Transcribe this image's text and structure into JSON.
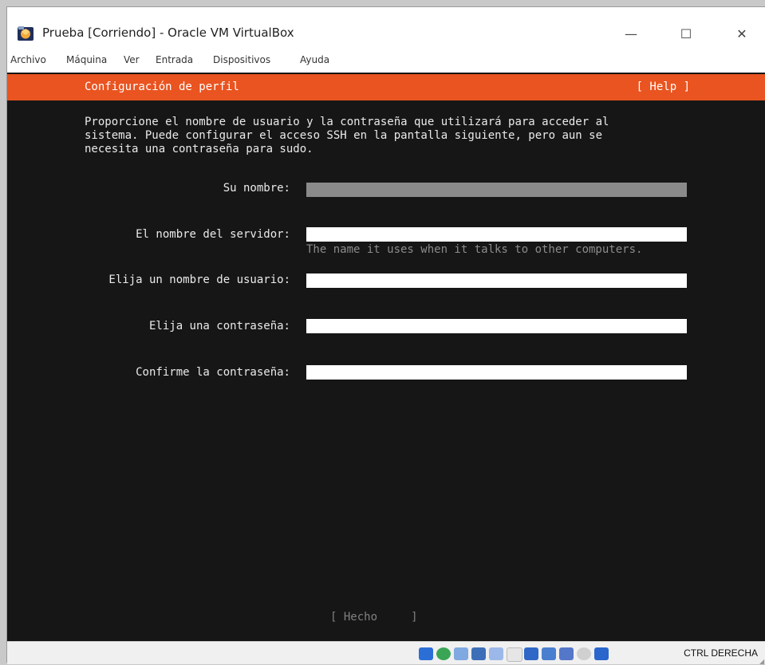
{
  "window": {
    "title": "Prueba [Corriendo] - Oracle VM VirtualBox",
    "minimize_glyph": "—",
    "maximize_glyph": "☐",
    "close_glyph": "✕"
  },
  "menu": {
    "items": [
      "Archivo",
      "Máquina",
      "Ver",
      "Entrada",
      "Dispositivos",
      "Ayuda"
    ]
  },
  "installer": {
    "header_title": "Configuración de perfil",
    "help_label": "[ Help ]",
    "accent_color": "#e95420",
    "intro_line1": "Proporcione el nombre de usuario y la contraseña que utilizará para acceder al",
    "intro_line2": "sistema. Puede configurar el acceso SSH en la pantalla siguiente, pero aun se",
    "intro_line3": "necesita una contraseña para sudo.",
    "fields": {
      "name_label": "Su nombre:",
      "name_value": "",
      "server_label": "El nombre del servidor:",
      "server_value": "",
      "server_hint": "The name it uses when it talks to other computers.",
      "username_label": "Elija un nombre de usuario:",
      "username_value": "",
      "password_label": "Elija una contraseña:",
      "password_value": "",
      "confirm_label": "Confirme la contraseña:",
      "confirm_value": ""
    },
    "done_label": "[ Hecho     ]"
  },
  "statusbar": {
    "icons": [
      "hard-disk-icon",
      "optical-drive-icon",
      "audio-icon",
      "network-icon",
      "usb-icon",
      "shared-folders-icon",
      "display-icon",
      "video-capture-icon",
      "recording-icon",
      "cpu-activity-icon",
      "mouse-integration-icon",
      "keyboard-icon"
    ],
    "host_key": "CTRL DERECHA"
  }
}
